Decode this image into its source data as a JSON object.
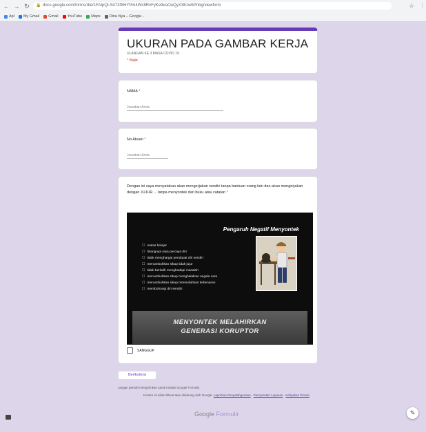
{
  "browser": {
    "url": "docs.google.com/forms/d/e/1FAIpQLSd7Xf8HYPm4Wc8RvFyKe9eaOuQyX3Ezw5Pnbg/viewform",
    "bookmarks": [
      {
        "label": "Apl",
        "color": "#4285f4"
      },
      {
        "label": "My Gmail",
        "color": "#1a73e8"
      },
      {
        "label": "Gmail",
        "color": "#ea4335"
      },
      {
        "label": "YouTube",
        "color": "#ff0000"
      },
      {
        "label": "Maps",
        "color": "#34a853"
      },
      {
        "label": "Dina Nya – Google...",
        "color": "#5f6368"
      }
    ]
  },
  "form": {
    "title": "UKURAN PADA GAMBAR KERJA",
    "subtitle": "ULANGAN KE 3 MASA COVID 19",
    "required_note": "* Wajib"
  },
  "questions": [
    {
      "label": "NAMA",
      "required_mark": " *",
      "placeholder": "Jawaban Anda"
    },
    {
      "label": "No Absen",
      "required_mark": " *",
      "placeholder": "Jawaban Anda"
    },
    {
      "label": "Dengan ini saya menyatakan akan mengerjakan sendiri tanpa bantuan orang lain dan akan mengerjakan dengan JUJUR ... tanpa menyontek dari buku atau catatan",
      "required_mark": " *"
    }
  ],
  "poster": {
    "title": "Pengaruh Negatif Menyontek",
    "items": [
      "malas belajar",
      "hilangnya rasa percaya diri",
      "tidak menghargai pendapat diri sendiri",
      "menumbuhkan sikap tidak jujur",
      "tidak berlatih menghadapi masalah",
      "menumbuhkan sikap menghalalkan segala cara",
      "menumbuhkan sikap merendahkan kebenaran",
      "membohongi diri sendiri"
    ],
    "banner_line1": "MENYONTEK MELAHIRKAN",
    "banner_line2": "GENERASI KORUPTOR"
  },
  "checkbox_label": "SANGGUP",
  "next_button": "Berikutnya",
  "footer": {
    "line1": "Jangan pernah mengirimkan sandi melalui Google Formulir.",
    "line2_pre": "Konten ini tidak dibuat atau didukung oleh Google. ",
    "link_abuse": "Laporkan Penyalahgunaan",
    "sep": " - ",
    "link_terms": "Persyaratan Layanan",
    "link_privacy": "Kebijakan Privasi",
    "brand_google": "Google",
    "brand_forms": " Formulir"
  }
}
